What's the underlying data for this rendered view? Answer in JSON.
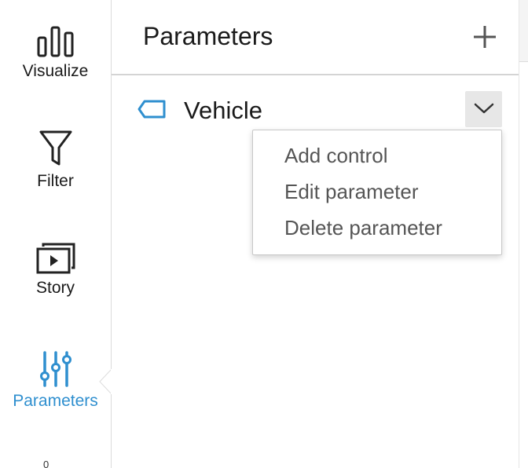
{
  "rail": {
    "items": [
      {
        "label": "Visualize",
        "icon": "bar-chart-icon"
      },
      {
        "label": "Filter",
        "icon": "funnel-icon"
      },
      {
        "label": "Story",
        "icon": "play-stack-icon"
      },
      {
        "label": "Parameters",
        "icon": "sliders-icon",
        "active": true
      }
    ],
    "more_label": "0"
  },
  "panel": {
    "title": "Parameters",
    "add_icon": "plus-icon"
  },
  "parameter": {
    "name": "Vehicle",
    "icon": "tag-icon"
  },
  "menu": {
    "items": [
      "Add control",
      "Edit parameter",
      "Delete parameter"
    ]
  },
  "colors": {
    "accent": "#2f8fcf",
    "text": "#1a1a1a",
    "menu_text": "#555555",
    "toggle_bg": "#e7e7e7"
  }
}
